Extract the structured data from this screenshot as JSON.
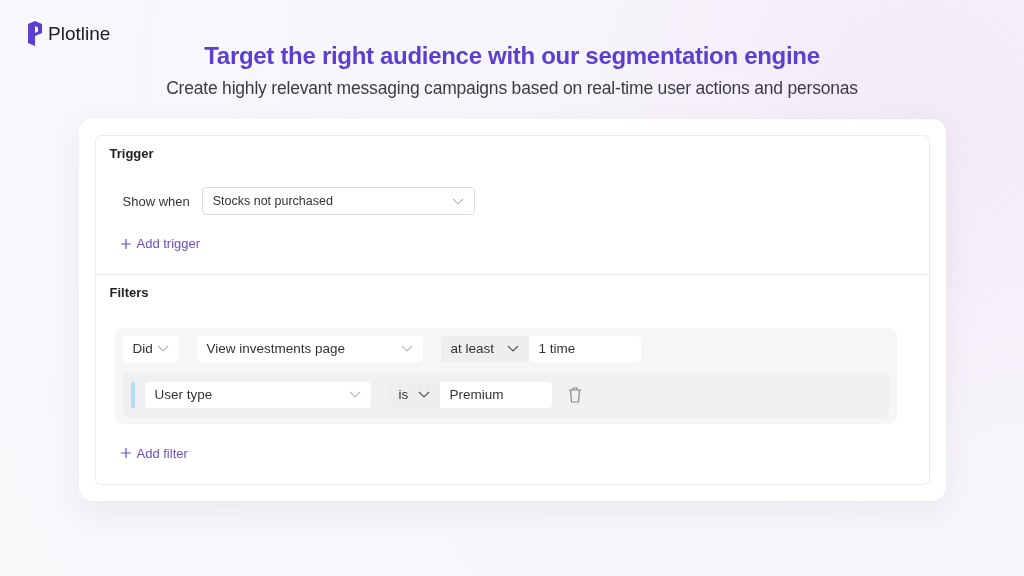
{
  "brand": {
    "name": "Plotline"
  },
  "headline": "Target the right audience with our segmentation engine",
  "subtitle": "Create highly relevant messaging campaigns based on real-time user actions and personas",
  "trigger": {
    "title": "Trigger",
    "label": "Show when",
    "value": "Stocks not purchased",
    "add": "Add trigger"
  },
  "filters": {
    "title": "Filters",
    "condition": {
      "verb": "Did",
      "event": "View investments page",
      "operator": "at least",
      "count": "1 time"
    },
    "property": {
      "field": "User type",
      "operator": "is",
      "value": "Premium"
    },
    "add": "Add filter"
  }
}
